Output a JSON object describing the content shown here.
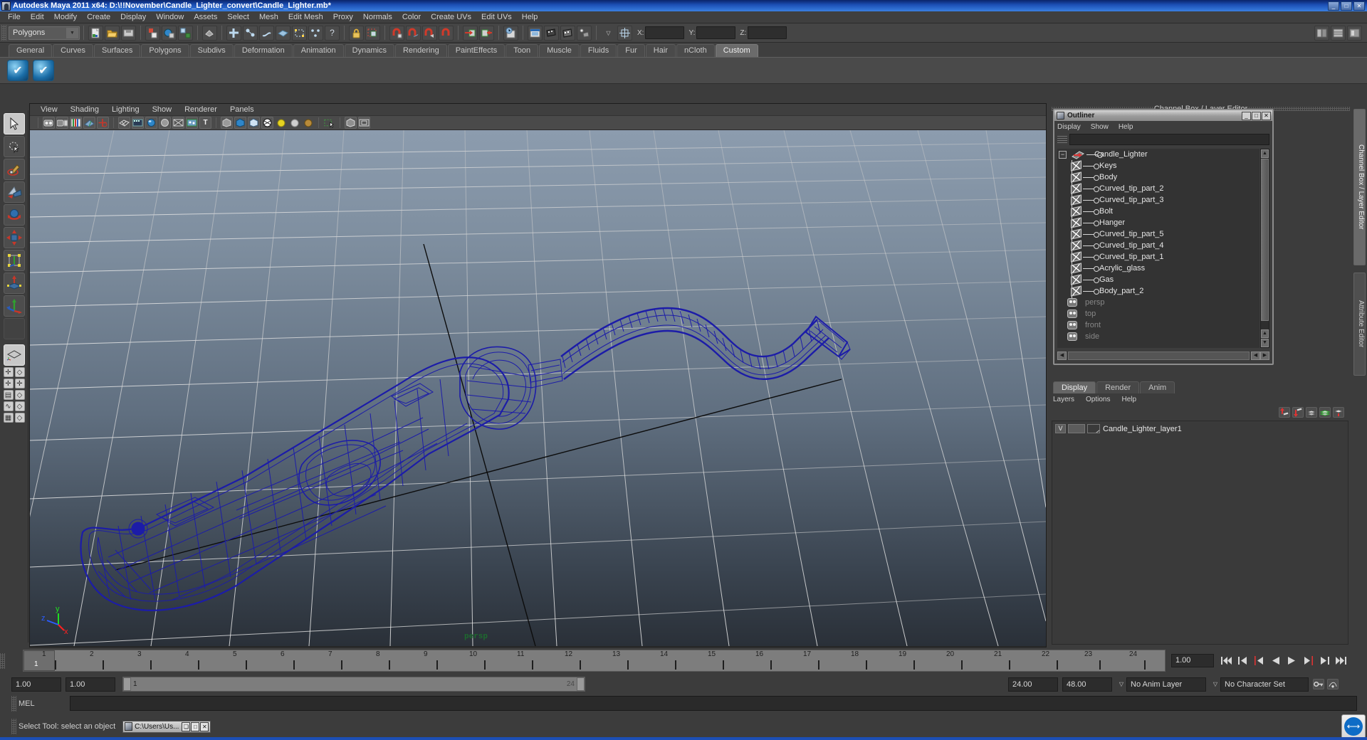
{
  "window": {
    "title": "Autodesk Maya 2011 x64: D:\\!!November\\Candle_Lighter_convert\\Candle_Lighter.mb*",
    "minimize": "_",
    "maximize": "□",
    "close": "✕",
    "icon": "maya-icon"
  },
  "menubar": {
    "items": [
      "File",
      "Edit",
      "Modify",
      "Create",
      "Display",
      "Window",
      "Assets",
      "Select",
      "Mesh",
      "Edit Mesh",
      "Proxy",
      "Normals",
      "Color",
      "Create UVs",
      "Edit UVs",
      "Help"
    ]
  },
  "statusbar": {
    "menu_set": "Polygons",
    "menu_set_arrow": "▼",
    "coord_labels": [
      "X:",
      "Y:",
      "Z:"
    ],
    "coord_values": [
      "",
      "",
      ""
    ],
    "icons": [
      "new-scene-icon",
      "open-scene-icon",
      "save-scene-icon",
      "undo-icon",
      "redo-icon",
      "select-by-hierarchy-icon",
      "select-by-object-icon",
      "select-by-component-icon",
      "component-mask-icon",
      "select-handles-icon",
      "select-points-icon",
      "select-lines-icon",
      "select-faces-icon",
      "select-uvs-icon",
      "select-vertices-icon",
      "select-mask-help-icon",
      "lock-icon",
      "highlight-selected-icon",
      "snap-to-grid-icon",
      "snap-to-curve-icon",
      "snap-to-point-icon",
      "snap-to-view-plane-icon",
      "snap-to-live-icon",
      "input-connections-icon",
      "output-connections-icon",
      "construction-history-icon",
      "render-view-icon",
      "render-current-frame-icon",
      "ipr-render-icon",
      "render-settings-icon",
      "show-manipulator-icon"
    ]
  },
  "shelf": {
    "tabs": [
      "General",
      "Curves",
      "Surfaces",
      "Polygons",
      "Subdivs",
      "Deformation",
      "Animation",
      "Dynamics",
      "Rendering",
      "PaintEffects",
      "Toon",
      "Muscle",
      "Fluids",
      "Fur",
      "Hair",
      "nCloth",
      "Custom"
    ],
    "active_tab": "Custom",
    "buttons": [
      "custom-shelf-button-1",
      "custom-shelf-button-2"
    ],
    "button_glyph": "✔"
  },
  "toolbox": {
    "tools": [
      {
        "name": "select-tool",
        "glyph": "➤",
        "selected": true
      },
      {
        "name": "lasso-select-tool",
        "glyph": "✎",
        "selected": false
      },
      {
        "name": "paint-select-tool",
        "glyph": "🖌",
        "selected": false
      },
      {
        "name": "move-tool",
        "glyph": "◣",
        "selected": false
      },
      {
        "name": "rotate-tool",
        "glyph": "◐",
        "selected": false
      },
      {
        "name": "scale-tool",
        "glyph": "✥",
        "selected": false
      },
      {
        "name": "universal-manipulator-tool",
        "glyph": "▣",
        "selected": false
      },
      {
        "name": "soft-modification-tool",
        "glyph": "⬆",
        "selected": false
      },
      {
        "name": "last-tool-used",
        "glyph": "✛",
        "selected": false
      },
      {
        "name": "blank-tool-slot",
        "glyph": "",
        "selected": false
      }
    ],
    "layout_buttons": [
      {
        "name": "single-perspective-view-layout",
        "glyph": "◇"
      },
      {
        "name": "four-view-layout",
        "glyph": "✛"
      },
      {
        "name": "persp-outliner-layout",
        "glyph": "▤"
      },
      {
        "name": "hypergraph-layout",
        "glyph": "◇"
      },
      {
        "name": "persp-graph-editor-layout",
        "glyph": "∿"
      },
      {
        "name": "hypershade-persp-layout",
        "glyph": "▦"
      }
    ]
  },
  "viewport": {
    "menus": [
      "View",
      "Shading",
      "Lighting",
      "Show",
      "Renderer",
      "Panels"
    ],
    "toolbar_icons": [
      "select-camera-icon",
      "camera-attributes-icon",
      "bookmarks-icon",
      "image-plane-icon",
      "two-d-pan-zoom-icon",
      "wireframe-icon",
      "smooth-shade-icon",
      "shaded-textured-icon",
      "lighting-icon",
      "xray-icon",
      "xray-joints-icon",
      "text-display-icon",
      "shadows-icon",
      "hardware-texturing-icon",
      "smooth-shade-all-icon",
      "wireframe-on-shaded-icon",
      "use-default-light-icon",
      "use-all-lights-icon",
      "hardware-light-icon",
      "isolate-select-icon",
      "xray-toggle-icon",
      "grid-toggle-icon"
    ],
    "camera_label": "persp",
    "axis_labels": {
      "x": "x",
      "y": "y",
      "z": "z"
    },
    "axis_colors": {
      "x": "#ff2020",
      "y": "#20e020",
      "z": "#2a5cff"
    },
    "background_top": "#8c9cae",
    "background_bottom": "#2a3038",
    "wireframe_color": "#1c1ca8",
    "grid_color": "#b9b9b9"
  },
  "right_panel": {
    "header": "Channel Box / Layer Editor",
    "vertical_tabs": [
      {
        "label": "Channel Box / Layer Editor",
        "active": true
      },
      {
        "label": "Attribute Editor",
        "active": false
      }
    ]
  },
  "outliner": {
    "title": "Outliner",
    "title_icon": "maya-icon",
    "window_buttons": [
      "_",
      "□",
      "✕"
    ],
    "menus": [
      "Display",
      "Show",
      "Help"
    ],
    "search_value": "",
    "search_placeholder": "",
    "expander": "−",
    "root": {
      "label": "Candle_Lighter",
      "icon": "transform-arrow-icon"
    },
    "children": [
      {
        "label": "Keys",
        "icon": "mesh-icon"
      },
      {
        "label": "Body",
        "icon": "mesh-icon"
      },
      {
        "label": "Curved_tip_part_2",
        "icon": "mesh-icon"
      },
      {
        "label": "Curved_tip_part_3",
        "icon": "mesh-icon"
      },
      {
        "label": "Bolt",
        "icon": "mesh-icon"
      },
      {
        "label": "Hanger",
        "icon": "mesh-icon"
      },
      {
        "label": "Curved_tip_part_5",
        "icon": "mesh-icon"
      },
      {
        "label": "Curved_tip_part_4",
        "icon": "mesh-icon"
      },
      {
        "label": "Curved_tip_part_1",
        "icon": "mesh-icon"
      },
      {
        "label": "Acrylic_glass",
        "icon": "mesh-icon"
      },
      {
        "label": "Gas",
        "icon": "mesh-icon"
      },
      {
        "label": "Body_part_2",
        "icon": "mesh-icon"
      }
    ],
    "cameras": [
      {
        "label": "persp",
        "icon": "camera-icon"
      },
      {
        "label": "top",
        "icon": "camera-icon"
      },
      {
        "label": "front",
        "icon": "camera-icon"
      },
      {
        "label": "side",
        "icon": "camera-icon"
      }
    ],
    "scroll_up": "▲",
    "scroll_down": "▼",
    "scroll_left": "◀",
    "scroll_right": "▶"
  },
  "layer_editor": {
    "tabs": [
      "Display",
      "Render",
      "Anim"
    ],
    "active_tab": "Display",
    "menus": [
      "Layers",
      "Options",
      "Help"
    ],
    "tool_icons": [
      "layer-move-up-icon",
      "layer-move-down-icon",
      "new-layer-icon",
      "new-layer-from-selected-icon",
      "layer-options-icon"
    ],
    "layers": [
      {
        "visibility": "V",
        "shading": "",
        "name": "Candle_Lighter_layer1"
      }
    ]
  },
  "timeline": {
    "ticks": [
      "1",
      "2",
      "3",
      "4",
      "5",
      "6",
      "7",
      "8",
      "9",
      "10",
      "11",
      "12",
      "13",
      "14",
      "15",
      "16",
      "17",
      "18",
      "19",
      "20",
      "21",
      "22",
      "23",
      "24"
    ],
    "current_frame_marker": "1",
    "current_frame_field": "1.00",
    "playback_buttons": [
      {
        "name": "go-to-start-button",
        "glyph": "⏮"
      },
      {
        "name": "step-back-frame-button",
        "glyph": "◀|"
      },
      {
        "name": "step-back-key-button",
        "glyph": "◀"
      },
      {
        "name": "play-backwards-button",
        "glyph": "◀"
      },
      {
        "name": "play-forwards-button",
        "glyph": "▶"
      },
      {
        "name": "step-forward-key-button",
        "glyph": "▶"
      },
      {
        "name": "step-forward-frame-button",
        "glyph": "|▶"
      },
      {
        "name": "go-to-end-button",
        "glyph": "⏭"
      }
    ]
  },
  "range_slider": {
    "anim_start": "1.00",
    "range_start": "1.00",
    "bar_start_label": "1",
    "bar_end_label": "24",
    "range_end": "24.00",
    "anim_end": "48.00",
    "anim_layer": "No Anim Layer",
    "character_set": "No Character Set",
    "dropdown_arrow": "▽",
    "key_icon": "auto-keyframe-icon",
    "prefs_icon": "animation-preferences-icon"
  },
  "command_line": {
    "label": "MEL",
    "value": "",
    "placeholder": ""
  },
  "help_line": {
    "text": "Select Tool: select an object",
    "taskbar_item": "C:\\Users\\Us...",
    "taskbar_buttons": [
      "❏",
      "□",
      "✕"
    ],
    "taskbar_icon": "console-icon"
  },
  "chart_data": null
}
